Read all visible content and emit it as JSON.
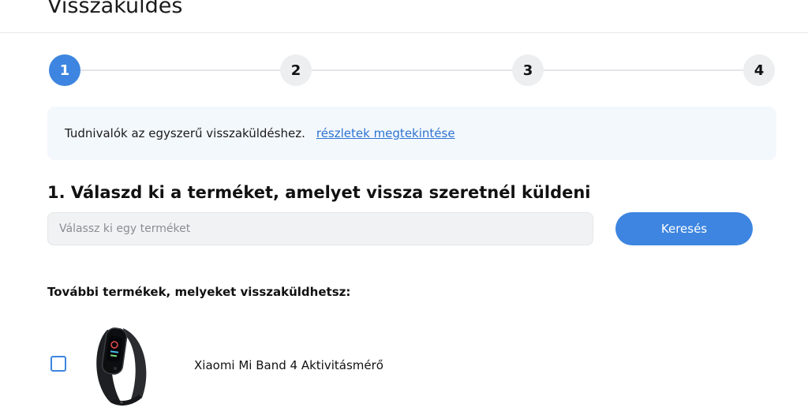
{
  "page": {
    "title": "Visszaküldés"
  },
  "stepper": {
    "steps": [
      "1",
      "2",
      "3",
      "4"
    ],
    "active_step": 1
  },
  "info": {
    "text": "Tudnivalók az egyszerű visszaküldéshez.",
    "link_label": "részletek megtekintése"
  },
  "section": {
    "heading": "1. Válaszd ki a terméket, amelyet vissza szeretnél küldeni"
  },
  "search": {
    "placeholder": "Válassz ki egy terméket",
    "value": "",
    "button_label": "Keresés"
  },
  "more_products": {
    "heading": "További termékek, melyeket visszaküldhetsz:",
    "items": [
      {
        "name": "Xiaomi Mi Band 4 Aktivitásmérő",
        "checked": false,
        "image_icon": "fitness-band-image"
      }
    ]
  },
  "colors": {
    "accent": "#3d85e0",
    "link": "#2d73d1",
    "info_bg": "#f3f8fd"
  }
}
